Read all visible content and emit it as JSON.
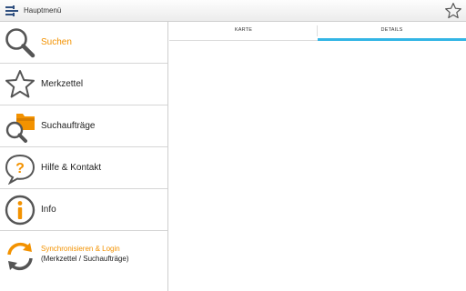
{
  "actionbar": {
    "title": "Hauptmenü",
    "logo_icon": "app-logo-icon",
    "favorite_icon": "star-outline-icon"
  },
  "menu": {
    "items": [
      {
        "label": "Suchen",
        "icon": "magnifier-icon",
        "active": true
      },
      {
        "label": "Merkzettel",
        "icon": "star-outline-icon"
      },
      {
        "label": "Suchaufträge",
        "icon": "folder-search-icon"
      },
      {
        "label": "Hilfe & Kontakt",
        "icon": "question-bubble-icon"
      },
      {
        "label": "Info",
        "icon": "info-circle-icon"
      },
      {
        "label": "Synchronisieren & Login",
        "sublabel": "(Merkzettel / Suchaufträge)",
        "icon": "sync-icon"
      }
    ]
  },
  "tabs": [
    {
      "label": "KARTE",
      "selected": false
    },
    {
      "label": "DETAILS",
      "selected": true
    }
  ],
  "colors": {
    "accent_orange": "#f39200",
    "tab_indicator": "#33b5e5",
    "icon_gray": "#555555"
  }
}
